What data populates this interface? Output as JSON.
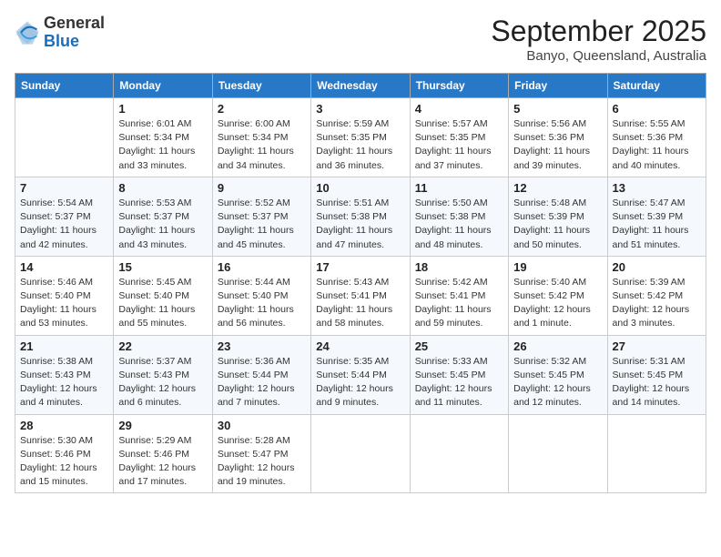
{
  "logo": {
    "general": "General",
    "blue": "Blue"
  },
  "header": {
    "month": "September 2025",
    "location": "Banyo, Queensland, Australia"
  },
  "weekdays": [
    "Sunday",
    "Monday",
    "Tuesday",
    "Wednesday",
    "Thursday",
    "Friday",
    "Saturday"
  ],
  "weeks": [
    [
      {
        "day": "",
        "info": ""
      },
      {
        "day": "1",
        "info": "Sunrise: 6:01 AM\nSunset: 5:34 PM\nDaylight: 11 hours\nand 33 minutes."
      },
      {
        "day": "2",
        "info": "Sunrise: 6:00 AM\nSunset: 5:34 PM\nDaylight: 11 hours\nand 34 minutes."
      },
      {
        "day": "3",
        "info": "Sunrise: 5:59 AM\nSunset: 5:35 PM\nDaylight: 11 hours\nand 36 minutes."
      },
      {
        "day": "4",
        "info": "Sunrise: 5:57 AM\nSunset: 5:35 PM\nDaylight: 11 hours\nand 37 minutes."
      },
      {
        "day": "5",
        "info": "Sunrise: 5:56 AM\nSunset: 5:36 PM\nDaylight: 11 hours\nand 39 minutes."
      },
      {
        "day": "6",
        "info": "Sunrise: 5:55 AM\nSunset: 5:36 PM\nDaylight: 11 hours\nand 40 minutes."
      }
    ],
    [
      {
        "day": "7",
        "info": "Sunrise: 5:54 AM\nSunset: 5:37 PM\nDaylight: 11 hours\nand 42 minutes."
      },
      {
        "day": "8",
        "info": "Sunrise: 5:53 AM\nSunset: 5:37 PM\nDaylight: 11 hours\nand 43 minutes."
      },
      {
        "day": "9",
        "info": "Sunrise: 5:52 AM\nSunset: 5:37 PM\nDaylight: 11 hours\nand 45 minutes."
      },
      {
        "day": "10",
        "info": "Sunrise: 5:51 AM\nSunset: 5:38 PM\nDaylight: 11 hours\nand 47 minutes."
      },
      {
        "day": "11",
        "info": "Sunrise: 5:50 AM\nSunset: 5:38 PM\nDaylight: 11 hours\nand 48 minutes."
      },
      {
        "day": "12",
        "info": "Sunrise: 5:48 AM\nSunset: 5:39 PM\nDaylight: 11 hours\nand 50 minutes."
      },
      {
        "day": "13",
        "info": "Sunrise: 5:47 AM\nSunset: 5:39 PM\nDaylight: 11 hours\nand 51 minutes."
      }
    ],
    [
      {
        "day": "14",
        "info": "Sunrise: 5:46 AM\nSunset: 5:40 PM\nDaylight: 11 hours\nand 53 minutes."
      },
      {
        "day": "15",
        "info": "Sunrise: 5:45 AM\nSunset: 5:40 PM\nDaylight: 11 hours\nand 55 minutes."
      },
      {
        "day": "16",
        "info": "Sunrise: 5:44 AM\nSunset: 5:40 PM\nDaylight: 11 hours\nand 56 minutes."
      },
      {
        "day": "17",
        "info": "Sunrise: 5:43 AM\nSunset: 5:41 PM\nDaylight: 11 hours\nand 58 minutes."
      },
      {
        "day": "18",
        "info": "Sunrise: 5:42 AM\nSunset: 5:41 PM\nDaylight: 11 hours\nand 59 minutes."
      },
      {
        "day": "19",
        "info": "Sunrise: 5:40 AM\nSunset: 5:42 PM\nDaylight: 12 hours\nand 1 minute."
      },
      {
        "day": "20",
        "info": "Sunrise: 5:39 AM\nSunset: 5:42 PM\nDaylight: 12 hours\nand 3 minutes."
      }
    ],
    [
      {
        "day": "21",
        "info": "Sunrise: 5:38 AM\nSunset: 5:43 PM\nDaylight: 12 hours\nand 4 minutes."
      },
      {
        "day": "22",
        "info": "Sunrise: 5:37 AM\nSunset: 5:43 PM\nDaylight: 12 hours\nand 6 minutes."
      },
      {
        "day": "23",
        "info": "Sunrise: 5:36 AM\nSunset: 5:44 PM\nDaylight: 12 hours\nand 7 minutes."
      },
      {
        "day": "24",
        "info": "Sunrise: 5:35 AM\nSunset: 5:44 PM\nDaylight: 12 hours\nand 9 minutes."
      },
      {
        "day": "25",
        "info": "Sunrise: 5:33 AM\nSunset: 5:45 PM\nDaylight: 12 hours\nand 11 minutes."
      },
      {
        "day": "26",
        "info": "Sunrise: 5:32 AM\nSunset: 5:45 PM\nDaylight: 12 hours\nand 12 minutes."
      },
      {
        "day": "27",
        "info": "Sunrise: 5:31 AM\nSunset: 5:45 PM\nDaylight: 12 hours\nand 14 minutes."
      }
    ],
    [
      {
        "day": "28",
        "info": "Sunrise: 5:30 AM\nSunset: 5:46 PM\nDaylight: 12 hours\nand 15 minutes."
      },
      {
        "day": "29",
        "info": "Sunrise: 5:29 AM\nSunset: 5:46 PM\nDaylight: 12 hours\nand 17 minutes."
      },
      {
        "day": "30",
        "info": "Sunrise: 5:28 AM\nSunset: 5:47 PM\nDaylight: 12 hours\nand 19 minutes."
      },
      {
        "day": "",
        "info": ""
      },
      {
        "day": "",
        "info": ""
      },
      {
        "day": "",
        "info": ""
      },
      {
        "day": "",
        "info": ""
      }
    ]
  ]
}
